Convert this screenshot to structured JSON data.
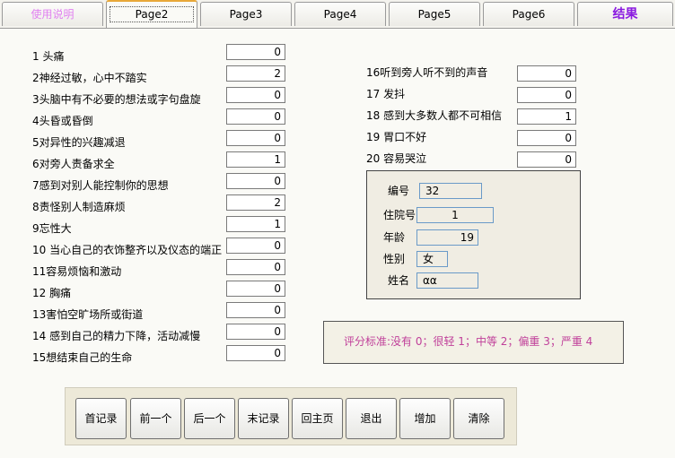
{
  "tabs": [
    "使用说明",
    "Page2",
    "Page3",
    "Page4",
    "Page5",
    "Page6",
    "结果"
  ],
  "questions": [
    {
      "label": "1 头痛",
      "value": "0"
    },
    {
      "label": "2神经过敏，心中不踏实",
      "value": "2"
    },
    {
      "label": "3头脑中有不必要的想法或字句盘旋",
      "value": "0"
    },
    {
      "label": "4头昏或昏倒",
      "value": "0"
    },
    {
      "label": "5对异性的兴趣减退",
      "value": "0"
    },
    {
      "label": "6对旁人责备求全",
      "value": "1"
    },
    {
      "label": "7感到对别人能控制你的思想",
      "value": "0"
    },
    {
      "label": "8责怪别人制造麻烦",
      "value": "2"
    },
    {
      "label": "9忘性大",
      "value": "1"
    },
    {
      "label": "10 当心自己的衣饰整齐以及仪态的端正",
      "value": "0"
    },
    {
      "label": "11容易烦恼和激动",
      "value": "0"
    },
    {
      "label": "12 胸痛",
      "value": "0"
    },
    {
      "label": "13害怕空旷场所或街道",
      "value": "0"
    },
    {
      "label": "14 感到自己的精力下降，活动减慢",
      "value": "0"
    },
    {
      "label": "15想结束自己的生命",
      "value": "0"
    },
    {
      "label": "16听到旁人听不到的声音",
      "value": "0"
    },
    {
      "label": "17 发抖",
      "value": "0"
    },
    {
      "label": "18 感到大多数人都不可相信",
      "value": "1"
    },
    {
      "label": "19 胃口不好",
      "value": "0"
    },
    {
      "label": "20 容易哭泣",
      "value": "0"
    }
  ],
  "patient": {
    "id_label": "编号",
    "id": "32",
    "inpatient_label": "住院号",
    "inpatient": "1",
    "age_label": "年龄",
    "age": "19",
    "sex_label": "性别",
    "sex": "女",
    "name_label": "姓名",
    "name": "αα"
  },
  "rule_text": "评分标准:没有 0；很轻 1；中等 2；偏重 3；严重 4",
  "buttons": [
    "首记录",
    "前一个",
    "后一个",
    "末记录",
    "回主页",
    "退出",
    "增加",
    "清除"
  ]
}
